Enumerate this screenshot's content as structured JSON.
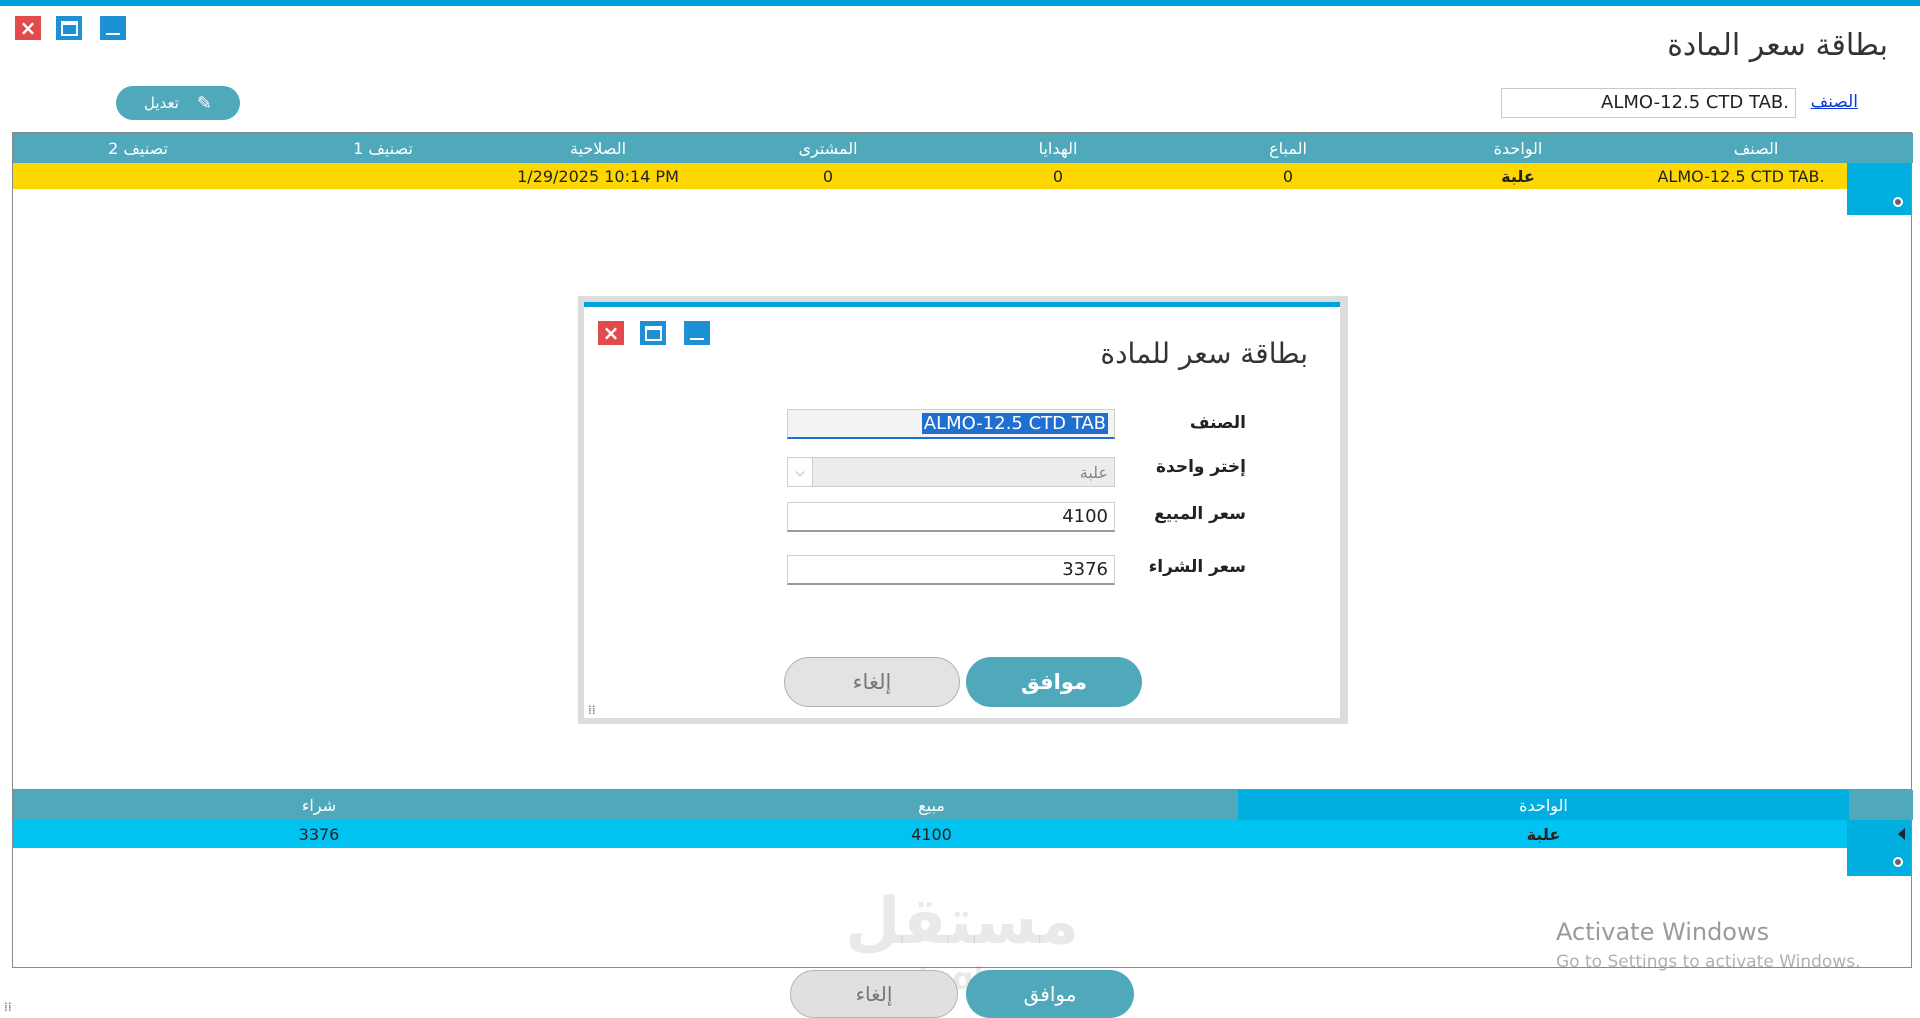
{
  "window": {
    "title": "بطاقة سعر المادة"
  },
  "toolbar": {
    "edit_label": "تعديل"
  },
  "search": {
    "link_label": "الصنف",
    "value": "ALMO-12.5 CTD TAB."
  },
  "items_grid": {
    "columns": [
      "الصنف",
      "الواحدة",
      "المباع",
      "الهدايا",
      "المشترى",
      "الصلاحية",
      "تصنيف 1",
      "تصنيف 2"
    ],
    "rows": [
      {
        "item": "ALMO-12.5 CTD TAB.",
        "unit": "علبة",
        "sold": "0",
        "gifts": "0",
        "purchased": "0",
        "expiry": "1/29/2025 10:14 PM",
        "class1": "",
        "class2": ""
      }
    ]
  },
  "units_grid": {
    "columns": [
      "الواحدة",
      "مبيع",
      "شراء"
    ],
    "rows": [
      {
        "unit": "علبة",
        "sale": "4100",
        "purchase": "3376"
      }
    ]
  },
  "bottom_buttons": {
    "ok_label": "موافق",
    "cancel_label": "إلغاء"
  },
  "dialog": {
    "title": "بطاقة سعر للمادة",
    "product_label": "الصنف",
    "product_value": "ALMO-12.5 CTD TAB",
    "unit_label": "إختر واحدة",
    "unit_value": "علبة",
    "sale_price_label": "سعر المبيع",
    "sale_price_value": "4100",
    "purchase_price_label": "سعر الشراء",
    "purchase_price_value": "3376",
    "ok_label": "موافق",
    "cancel_label": "إلغاء"
  },
  "watermark": {
    "title": "Activate Windows",
    "subtitle": "Go to Settings to activate Windows.",
    "brand": "مستقل",
    "brand_sub": "mostaql.com"
  },
  "colors": {
    "accent": "#00a3d9",
    "header": "#4fa9bb",
    "highlight_row": "#ffd700",
    "selected_row": "#00c3f2",
    "close": "#e24b4b"
  },
  "icons": {
    "close": "close-icon",
    "maximize": "maximize-icon",
    "minimize": "minimize-icon",
    "edit": "pencil-icon"
  }
}
